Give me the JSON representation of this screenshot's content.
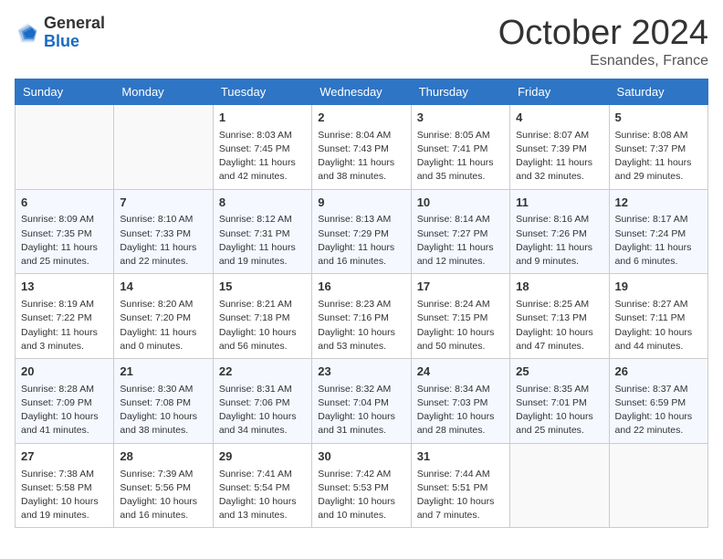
{
  "header": {
    "logo_general": "General",
    "logo_blue": "Blue",
    "month_title": "October 2024",
    "subtitle": "Esnandes, France"
  },
  "weekdays": [
    "Sunday",
    "Monday",
    "Tuesday",
    "Wednesday",
    "Thursday",
    "Friday",
    "Saturday"
  ],
  "weeks": [
    [
      {
        "day": "",
        "info": ""
      },
      {
        "day": "",
        "info": ""
      },
      {
        "day": "1",
        "info": "Sunrise: 8:03 AM\nSunset: 7:45 PM\nDaylight: 11 hours and 42 minutes."
      },
      {
        "day": "2",
        "info": "Sunrise: 8:04 AM\nSunset: 7:43 PM\nDaylight: 11 hours and 38 minutes."
      },
      {
        "day": "3",
        "info": "Sunrise: 8:05 AM\nSunset: 7:41 PM\nDaylight: 11 hours and 35 minutes."
      },
      {
        "day": "4",
        "info": "Sunrise: 8:07 AM\nSunset: 7:39 PM\nDaylight: 11 hours and 32 minutes."
      },
      {
        "day": "5",
        "info": "Sunrise: 8:08 AM\nSunset: 7:37 PM\nDaylight: 11 hours and 29 minutes."
      }
    ],
    [
      {
        "day": "6",
        "info": "Sunrise: 8:09 AM\nSunset: 7:35 PM\nDaylight: 11 hours and 25 minutes."
      },
      {
        "day": "7",
        "info": "Sunrise: 8:10 AM\nSunset: 7:33 PM\nDaylight: 11 hours and 22 minutes."
      },
      {
        "day": "8",
        "info": "Sunrise: 8:12 AM\nSunset: 7:31 PM\nDaylight: 11 hours and 19 minutes."
      },
      {
        "day": "9",
        "info": "Sunrise: 8:13 AM\nSunset: 7:29 PM\nDaylight: 11 hours and 16 minutes."
      },
      {
        "day": "10",
        "info": "Sunrise: 8:14 AM\nSunset: 7:27 PM\nDaylight: 11 hours and 12 minutes."
      },
      {
        "day": "11",
        "info": "Sunrise: 8:16 AM\nSunset: 7:26 PM\nDaylight: 11 hours and 9 minutes."
      },
      {
        "day": "12",
        "info": "Sunrise: 8:17 AM\nSunset: 7:24 PM\nDaylight: 11 hours and 6 minutes."
      }
    ],
    [
      {
        "day": "13",
        "info": "Sunrise: 8:19 AM\nSunset: 7:22 PM\nDaylight: 11 hours and 3 minutes."
      },
      {
        "day": "14",
        "info": "Sunrise: 8:20 AM\nSunset: 7:20 PM\nDaylight: 11 hours and 0 minutes."
      },
      {
        "day": "15",
        "info": "Sunrise: 8:21 AM\nSunset: 7:18 PM\nDaylight: 10 hours and 56 minutes."
      },
      {
        "day": "16",
        "info": "Sunrise: 8:23 AM\nSunset: 7:16 PM\nDaylight: 10 hours and 53 minutes."
      },
      {
        "day": "17",
        "info": "Sunrise: 8:24 AM\nSunset: 7:15 PM\nDaylight: 10 hours and 50 minutes."
      },
      {
        "day": "18",
        "info": "Sunrise: 8:25 AM\nSunset: 7:13 PM\nDaylight: 10 hours and 47 minutes."
      },
      {
        "day": "19",
        "info": "Sunrise: 8:27 AM\nSunset: 7:11 PM\nDaylight: 10 hours and 44 minutes."
      }
    ],
    [
      {
        "day": "20",
        "info": "Sunrise: 8:28 AM\nSunset: 7:09 PM\nDaylight: 10 hours and 41 minutes."
      },
      {
        "day": "21",
        "info": "Sunrise: 8:30 AM\nSunset: 7:08 PM\nDaylight: 10 hours and 38 minutes."
      },
      {
        "day": "22",
        "info": "Sunrise: 8:31 AM\nSunset: 7:06 PM\nDaylight: 10 hours and 34 minutes."
      },
      {
        "day": "23",
        "info": "Sunrise: 8:32 AM\nSunset: 7:04 PM\nDaylight: 10 hours and 31 minutes."
      },
      {
        "day": "24",
        "info": "Sunrise: 8:34 AM\nSunset: 7:03 PM\nDaylight: 10 hours and 28 minutes."
      },
      {
        "day": "25",
        "info": "Sunrise: 8:35 AM\nSunset: 7:01 PM\nDaylight: 10 hours and 25 minutes."
      },
      {
        "day": "26",
        "info": "Sunrise: 8:37 AM\nSunset: 6:59 PM\nDaylight: 10 hours and 22 minutes."
      }
    ],
    [
      {
        "day": "27",
        "info": "Sunrise: 7:38 AM\nSunset: 5:58 PM\nDaylight: 10 hours and 19 minutes."
      },
      {
        "day": "28",
        "info": "Sunrise: 7:39 AM\nSunset: 5:56 PM\nDaylight: 10 hours and 16 minutes."
      },
      {
        "day": "29",
        "info": "Sunrise: 7:41 AM\nSunset: 5:54 PM\nDaylight: 10 hours and 13 minutes."
      },
      {
        "day": "30",
        "info": "Sunrise: 7:42 AM\nSunset: 5:53 PM\nDaylight: 10 hours and 10 minutes."
      },
      {
        "day": "31",
        "info": "Sunrise: 7:44 AM\nSunset: 5:51 PM\nDaylight: 10 hours and 7 minutes."
      },
      {
        "day": "",
        "info": ""
      },
      {
        "day": "",
        "info": ""
      }
    ]
  ]
}
